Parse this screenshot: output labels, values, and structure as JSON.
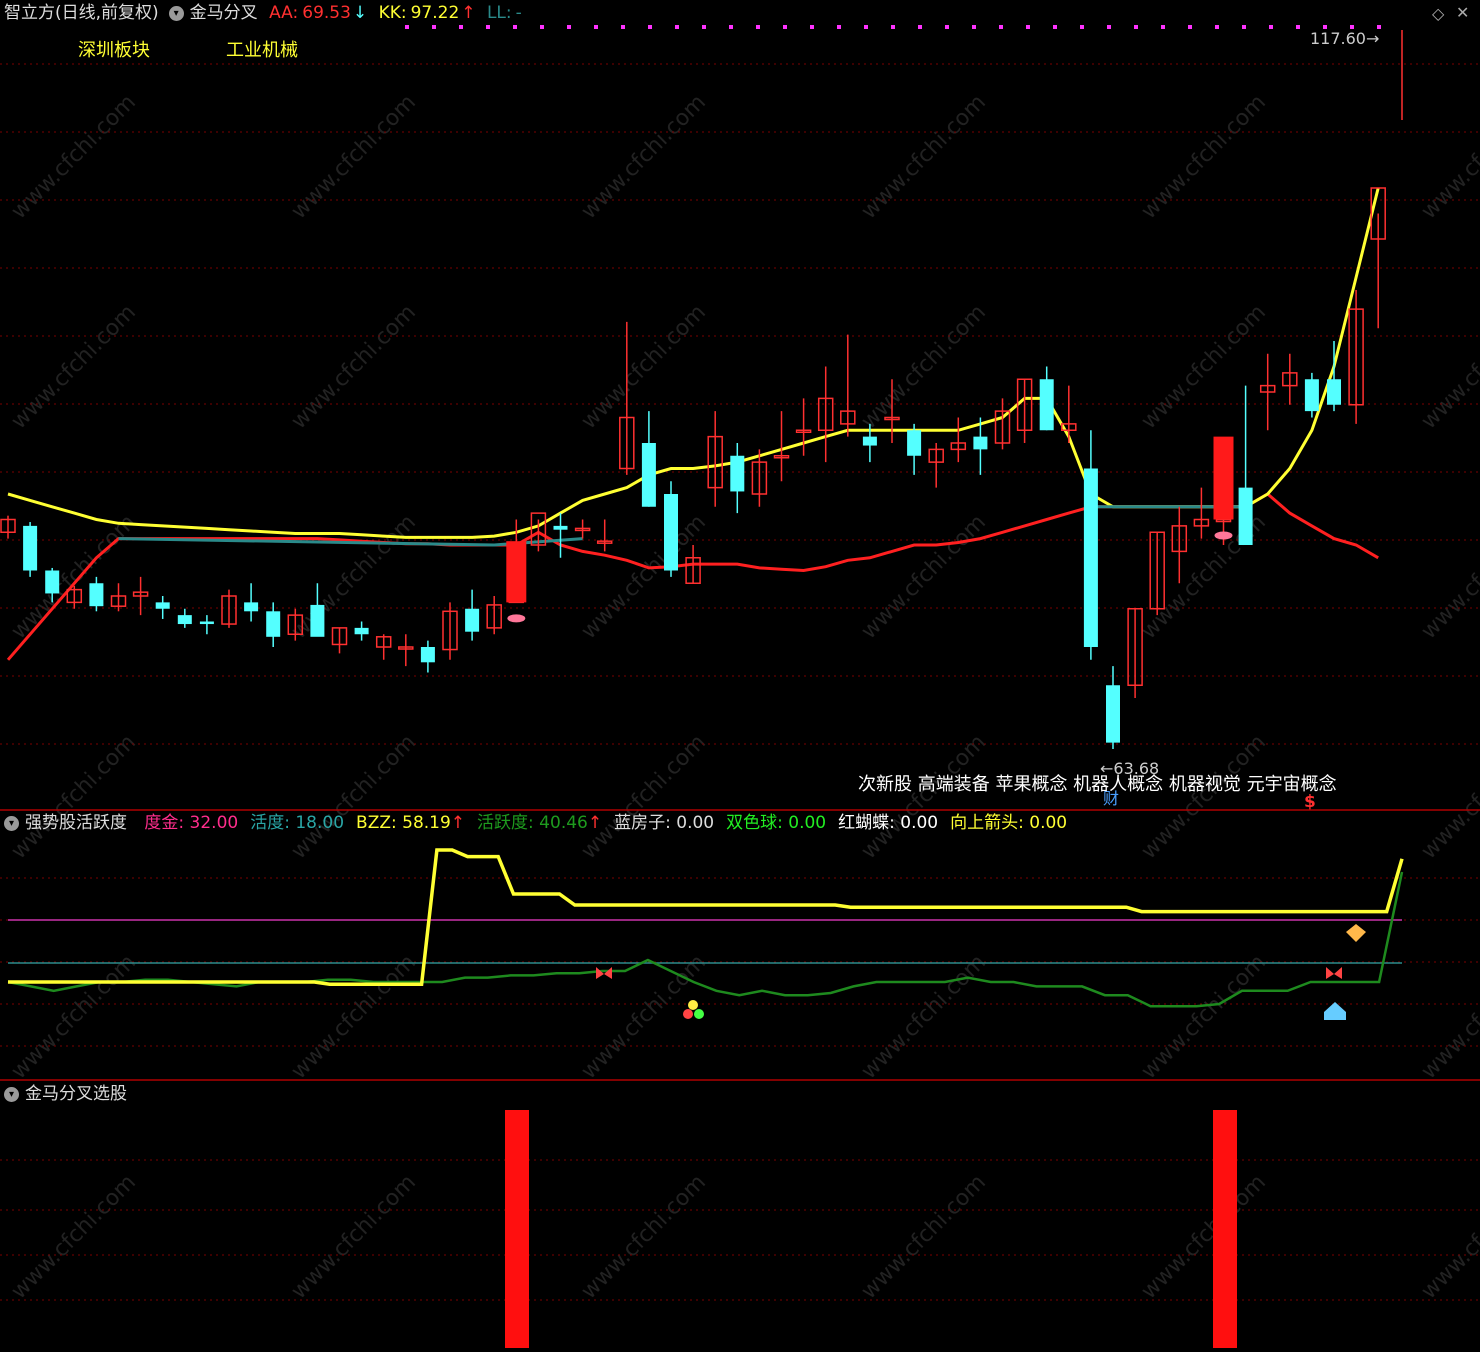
{
  "header": {
    "app": "智立方(日线,前复权)",
    "indicator": "金马分叉",
    "aa_label": "AA:",
    "aa_value": "69.53",
    "aa_arrow": "↓",
    "kk_label": "KK:",
    "kk_value": "97.22",
    "kk_arrow": "↑",
    "ll_label": "LL:",
    "ll_value": "-"
  },
  "tags": {
    "sector1": "深圳板块",
    "sector2": "工业机械"
  },
  "concepts": "次新股 高端装备 苹果概念 机器人概念 机器视觉 元宇宙概念",
  "markers": {
    "cai": "财",
    "dollar": "$",
    "high": "117.60",
    "low": "63.68"
  },
  "watermark": "www.cfchi.com",
  "panel2": {
    "title": "强势股活跃度",
    "items": [
      {
        "label": "度金:",
        "value": "32.00",
        "color": "#ff2d8c"
      },
      {
        "label": "活度:",
        "value": "18.00",
        "color": "#2aa6a6"
      },
      {
        "label": "BZZ:",
        "value": "58.19",
        "arrow": "↑",
        "color": "#ffff33"
      },
      {
        "label": "活跃度:",
        "value": "40.46",
        "arrow": "↑",
        "color": "#1e9b1e"
      },
      {
        "label": "蓝房子:",
        "value": "0.00",
        "color": "#dddddd"
      },
      {
        "label": "双色球:",
        "value": "0.00",
        "color": "#22ee22"
      },
      {
        "label": "红蝴蝶:",
        "value": "0.00",
        "color": "#ffffff"
      },
      {
        "label": "向上箭头:",
        "value": "0.00",
        "color": "#ffff33"
      }
    ]
  },
  "panel3": {
    "title": "金马分叉选股"
  },
  "colors": {
    "up": "#ff3030",
    "down": "#54ffff",
    "yellow": "#ffff33",
    "red": "#ff2020",
    "teal": "#2a8a8a",
    "green": "#1e8a1e",
    "grid": "#7a0000"
  },
  "chart_data": [
    {
      "type": "candlestick",
      "title": "金马分叉",
      "ylim": [
        60,
        120
      ],
      "x": [
        1,
        2,
        3,
        4,
        5,
        6,
        7,
        8,
        9,
        10,
        11,
        12,
        13,
        14,
        15,
        16,
        17,
        18,
        19,
        20,
        21,
        22,
        23,
        24,
        25,
        26,
        27,
        28,
        29,
        30,
        31,
        32,
        33,
        34,
        35,
        36,
        37,
        38,
        39,
        40,
        41,
        42,
        43,
        44,
        45,
        46,
        47,
        48,
        49,
        50,
        51,
        52,
        53,
        54,
        55,
        56,
        57,
        58,
        59,
        60,
        61,
        62,
        63
      ],
      "ohlc": [
        [
          81.0,
          82.3,
          80.5,
          82.0
        ],
        [
          81.5,
          81.8,
          77.5,
          78.0
        ],
        [
          78.0,
          78.2,
          75.5,
          76.2
        ],
        [
          75.5,
          76.8,
          75.0,
          76.5
        ],
        [
          77.0,
          77.5,
          74.8,
          75.2
        ],
        [
          75.2,
          77.0,
          74.8,
          76.0
        ],
        [
          76.0,
          77.5,
          74.5,
          76.3
        ],
        [
          75.5,
          76.0,
          74.2,
          75.0
        ],
        [
          74.5,
          75.0,
          73.5,
          73.8
        ],
        [
          74.0,
          74.5,
          73.0,
          73.8
        ],
        [
          73.8,
          76.5,
          73.5,
          76.0
        ],
        [
          75.5,
          77.0,
          74.0,
          74.8
        ],
        [
          74.8,
          75.5,
          72.0,
          72.8
        ],
        [
          73.0,
          75.0,
          72.5,
          74.5
        ],
        [
          75.3,
          77.0,
          73.0,
          72.8
        ],
        [
          72.2,
          73.5,
          71.5,
          73.5
        ],
        [
          73.5,
          74.0,
          72.5,
          73.0
        ],
        [
          72.0,
          73.0,
          71.0,
          72.8
        ],
        [
          72.0,
          73.0,
          70.5,
          72.0
        ],
        [
          72.0,
          72.5,
          70.0,
          70.8
        ],
        [
          71.8,
          75.5,
          71.0,
          74.8
        ],
        [
          75.0,
          76.5,
          72.5,
          73.2
        ],
        [
          73.5,
          76.0,
          73.0,
          75.3
        ],
        [
          75.5,
          82.0,
          75.5,
          80.0
        ],
        [
          80.0,
          82.0,
          79.5,
          82.5
        ],
        [
          81.5,
          82.5,
          79.0,
          81.2
        ],
        [
          81.3,
          82.0,
          80.5,
          81.3
        ],
        [
          80.3,
          82.0,
          79.5,
          80.3
        ],
        [
          86.0,
          97.5,
          85.5,
          90.0
        ],
        [
          88.0,
          90.5,
          83.0,
          83.0
        ],
        [
          84.0,
          85.0,
          77.5,
          78.0
        ],
        [
          77.0,
          80.0,
          77.0,
          79.0
        ],
        [
          84.5,
          90.5,
          83.0,
          88.5
        ],
        [
          87.0,
          88.0,
          82.5,
          84.2
        ],
        [
          84.0,
          87.5,
          83.0,
          86.5
        ],
        [
          87.0,
          90.5,
          85.0,
          87.0
        ],
        [
          89.0,
          91.5,
          87.0,
          89.0
        ],
        [
          89.0,
          94.0,
          86.5,
          91.5
        ],
        [
          89.5,
          96.5,
          88.5,
          90.5
        ],
        [
          88.5,
          89.5,
          86.5,
          87.8
        ],
        [
          90.0,
          93.0,
          88.0,
          90.0
        ],
        [
          89.0,
          89.5,
          85.5,
          87.0
        ],
        [
          86.5,
          88.0,
          84.5,
          87.5
        ],
        [
          87.5,
          90.0,
          86.5,
          88.0
        ],
        [
          88.5,
          90.0,
          85.5,
          87.5
        ],
        [
          88.0,
          91.5,
          87.5,
          90.5
        ],
        [
          89.0,
          93.0,
          88.0,
          93.0
        ],
        [
          93.0,
          94.0,
          89.0,
          89.0
        ],
        [
          89.0,
          92.5,
          88.0,
          89.5
        ],
        [
          86.0,
          89.0,
          71.0,
          72.0
        ],
        [
          69.0,
          70.5,
          64.0,
          64.5
        ],
        [
          69.0,
          75.0,
          68.0,
          75.0
        ],
        [
          75.0,
          81.0,
          74.5,
          81.0
        ],
        [
          79.5,
          83.0,
          77.0,
          81.5
        ],
        [
          81.5,
          84.5,
          80.5,
          82.0
        ],
        [
          82.0,
          83.0,
          80.0,
          82.0
        ],
        [
          84.5,
          92.5,
          81.5,
          80.0
        ],
        [
          92.0,
          95.0,
          89.0,
          92.5
        ],
        [
          92.5,
          95.0,
          91.0,
          93.5
        ],
        [
          93.0,
          93.5,
          90.0,
          90.5
        ],
        [
          93.0,
          96.0,
          90.5,
          91.0
        ],
        [
          91.0,
          100.0,
          89.5,
          98.5
        ],
        [
          104.0,
          106.0,
          97.0,
          108.0
        ]
      ],
      "series": [
        {
          "name": "LL",
          "values": [
            84.0,
            83.5,
            83.0,
            82.5,
            82.0,
            81.7,
            81.6,
            81.5,
            81.4,
            81.3,
            81.2,
            81.1,
            81.0,
            80.9,
            80.9,
            80.9,
            80.8,
            80.7,
            80.6,
            80.6,
            80.6,
            80.6,
            80.7,
            81.0,
            81.5,
            82.5,
            83.5,
            84.0,
            84.5,
            85.5,
            86.0,
            86.0,
            86.2,
            86.5,
            87.0,
            87.5,
            88.0,
            88.5,
            89.0,
            89.0,
            89.0,
            89.0,
            89.0,
            89.0,
            89.5,
            90.0,
            91.5,
            91.5,
            88.5,
            84.0,
            83.0,
            83.0,
            83.0,
            83.0,
            83.0,
            83.0,
            83.0,
            84.0,
            86.0,
            89.0,
            94.0,
            101.0,
            108.0
          ]
        },
        {
          "name": "",
          "values": [
            71.0,
            73.0,
            75.0,
            77.0,
            79.0,
            80.5,
            80.5,
            80.5,
            80.5,
            80.5,
            80.5,
            80.5,
            80.5,
            80.5,
            80.5,
            80.4,
            80.3,
            80.2,
            80.1,
            80.1,
            80.0,
            80.0,
            80.0,
            80.0,
            81.0,
            80.0,
            79.5,
            79.2,
            78.8,
            78.2,
            78.3,
            78.5,
            78.5,
            78.5,
            78.2,
            78.1,
            78.0,
            78.3,
            78.8,
            79.0,
            79.5,
            80.0,
            80.0,
            80.2,
            80.5,
            81.0,
            81.5,
            82.0,
            82.5,
            83.0,
            83.0,
            83.0,
            83.0,
            83.0,
            83.0,
            83.0,
            83.0,
            84.0,
            82.5,
            81.5,
            80.5,
            80.0,
            79.0
          ]
        }
      ]
    },
    {
      "type": "line",
      "title": "强势股活跃度",
      "series": [
        {
          "name": "BZZ",
          "values": [
            40,
            40,
            40,
            40,
            40,
            40,
            40,
            40,
            40,
            40,
            40,
            40,
            40,
            40,
            40,
            40,
            40,
            40,
            40,
            40,
            40,
            39,
            39,
            39,
            39,
            39,
            39,
            39,
            100,
            100,
            97,
            97,
            97,
            80,
            80,
            80,
            80,
            75,
            75,
            75,
            75,
            75,
            75,
            75,
            75,
            75,
            75,
            75,
            75,
            75,
            75,
            75,
            75,
            75,
            75,
            74,
            74,
            74,
            74,
            74,
            74,
            74,
            74,
            74,
            74,
            74,
            74,
            74,
            74,
            74,
            74,
            74,
            74,
            74,
            72,
            72,
            72,
            72,
            72,
            72,
            72,
            72,
            72,
            72,
            72,
            72,
            72,
            72,
            72,
            72,
            72,
            96
          ]
        },
        {
          "name": "活跃度",
          "values": [
            40,
            38,
            36,
            38,
            40,
            40,
            41,
            41,
            40,
            39,
            38,
            40,
            40,
            40,
            41,
            41,
            40,
            40,
            40,
            40,
            42,
            42,
            43,
            43,
            44,
            44,
            45,
            45,
            50,
            45,
            40,
            36,
            34,
            36,
            34,
            34,
            35,
            38,
            40,
            40,
            40,
            40,
            42,
            40,
            40,
            38,
            38,
            38,
            34,
            34,
            29,
            29,
            29,
            30,
            36,
            36,
            36,
            40,
            40,
            40,
            40,
            90
          ]
        }
      ]
    },
    {
      "type": "bar",
      "title": "金马分叉选股",
      "categories": [
        23,
        56
      ],
      "values": [
        1,
        1
      ]
    }
  ]
}
